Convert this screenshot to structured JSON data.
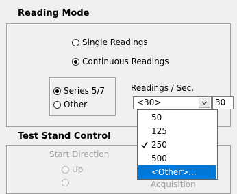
{
  "reading_mode": {
    "title": "Reading Mode",
    "single_label": "Single Readings",
    "continuous_label": "Continuous Readings",
    "selected": "Continuous Readings"
  },
  "series": {
    "series57_label": "Series 5/7",
    "other_label": "Other",
    "selected": "Series 5/7"
  },
  "readings_per_sec": {
    "label": "Readings / Sec.",
    "selected_value": "<30>",
    "text_value": "30",
    "options": [
      "50",
      "125",
      "250",
      "500",
      "<Other>..."
    ],
    "checked_option": "250",
    "highlighted_option": "<Other>..."
  },
  "test_stand": {
    "title": "Test Stand Control",
    "start_direction_label": "Start Direction",
    "up_label": "Up",
    "partial_label": "Acquisition"
  },
  "icons": {
    "dropdown": "chevron-down-icon",
    "checkmark": "checkmark-icon"
  },
  "colors": {
    "highlight": "#0078d7",
    "background": "#f0f0f0"
  }
}
